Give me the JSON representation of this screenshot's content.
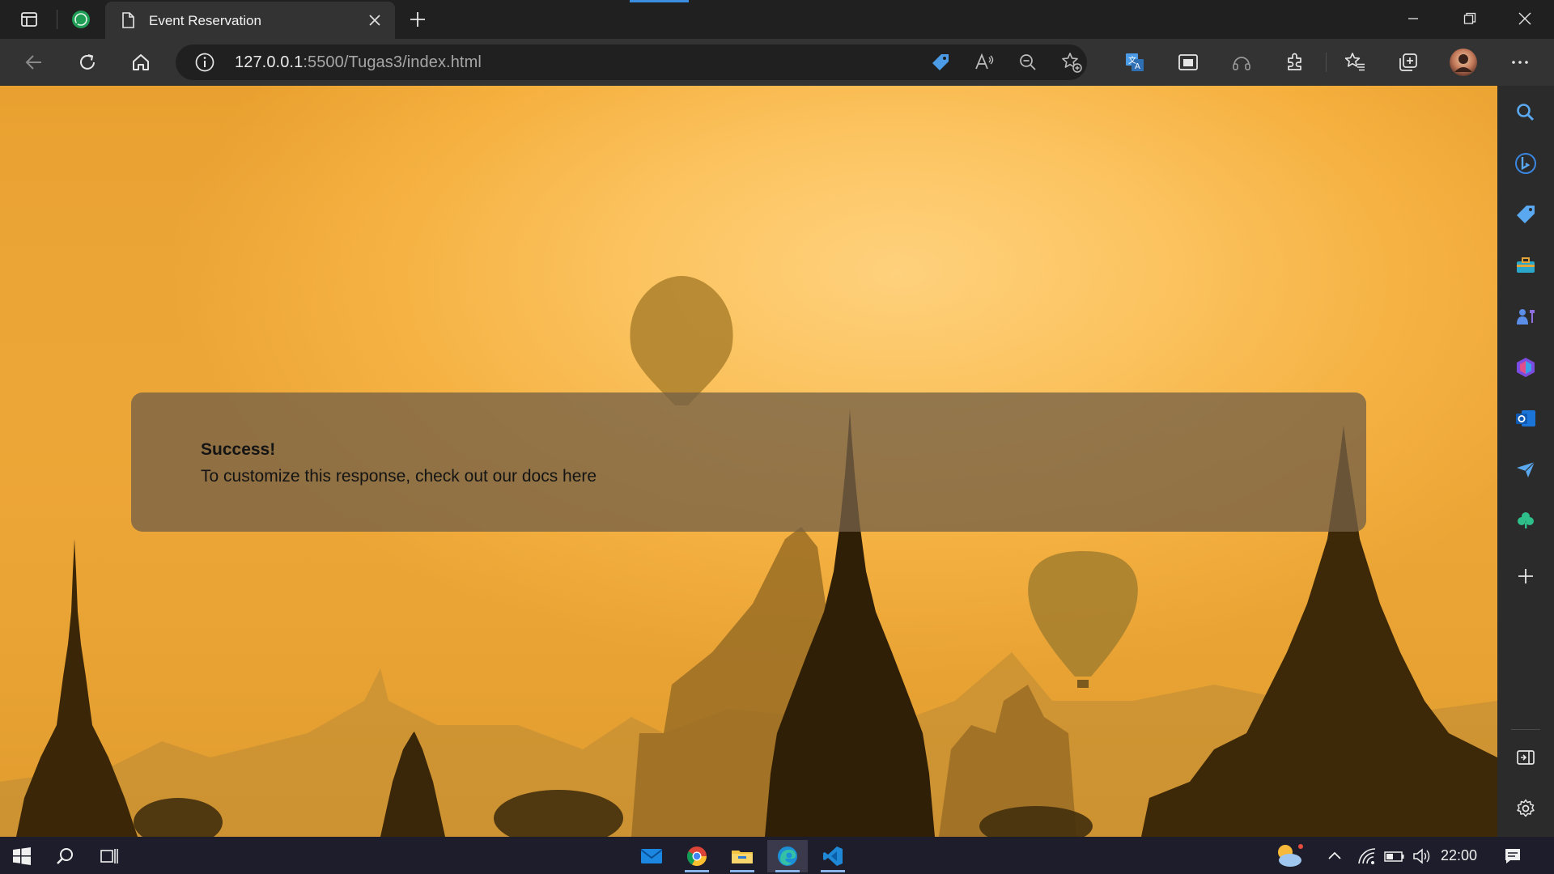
{
  "browser": {
    "tab": {
      "title": "Event Reservation"
    },
    "address": {
      "host": "127.0.0.1",
      "rest": ":5500/Tugas3/index.html"
    }
  },
  "page": {
    "alert": {
      "title": "Success!",
      "message": "To customize this response, check out our docs here"
    }
  },
  "taskbar": {
    "time": "22:00"
  },
  "colors": {
    "accent": "#3b8de0",
    "alert_bg": "#766246",
    "sky": "#fcc35f"
  },
  "icons": {
    "titlebar": [
      "tab-actions-icon",
      "whatsapp-icon",
      "document-icon",
      "close-icon",
      "plus-icon",
      "minimize-icon",
      "restore-icon",
      "close-window-icon"
    ],
    "navbar": [
      "back-icon",
      "refresh-icon",
      "home-icon",
      "info-icon",
      "coupon-icon",
      "read-aloud-icon",
      "zoom-out-icon",
      "add-favorite-icon",
      "translate-icon",
      "immersive-reader-icon",
      "headset-icon",
      "extensions-icon",
      "favorites-icon",
      "collections-icon",
      "profile-avatar",
      "more-icon"
    ],
    "sidebar": [
      "search-icon",
      "bing-icon",
      "shopping-icon",
      "tools-icon",
      "games-icon",
      "microsoft365-icon",
      "outlook-icon",
      "drop-icon",
      "tree-icon",
      "add-icon",
      "hide-sidebar-icon",
      "settings-icon"
    ],
    "taskbar": [
      "start-icon",
      "search-icon",
      "task-view-icon",
      "mail-icon",
      "chrome-icon",
      "file-explorer-icon",
      "edge-icon",
      "vscode-icon",
      "weather-icon",
      "chevron-up-icon",
      "wifi-icon",
      "battery-icon",
      "volume-icon",
      "notification-icon"
    ]
  }
}
